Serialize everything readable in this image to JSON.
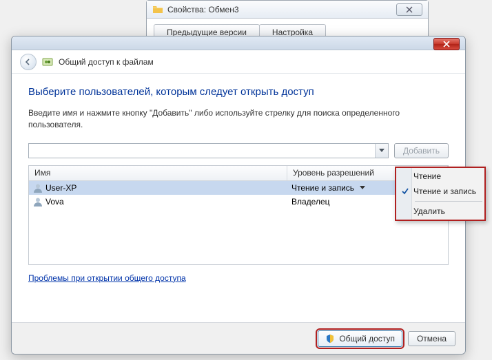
{
  "bg_window": {
    "title": "Свойства: Обмен3",
    "tabs": [
      "Предыдущие версии",
      "Настройка"
    ]
  },
  "dialog": {
    "crumb_title": "Общий доступ к файлам",
    "heading": "Выберите пользователей, которым следует открыть доступ",
    "instruction": "Введите имя и нажмите кнопку \"Добавить\" либо используйте стрелку для поиска определенного пользователя.",
    "add_button": "Добавить",
    "columns": {
      "name": "Имя",
      "perm": "Уровень разрешений"
    },
    "rows": [
      {
        "name": "User-XP",
        "perm": "Чтение и запись",
        "selected": true,
        "dropdown": true
      },
      {
        "name": "Vova",
        "perm": "Владелец",
        "selected": false,
        "dropdown": false
      }
    ],
    "trouble_link": "Проблемы при открытии общего доступа",
    "share_button": "Общий доступ",
    "cancel_button": "Отмена"
  },
  "context_menu": {
    "read": "Чтение",
    "read_write": "Чтение и запись",
    "delete": "Удалить",
    "checked": "read_write"
  }
}
